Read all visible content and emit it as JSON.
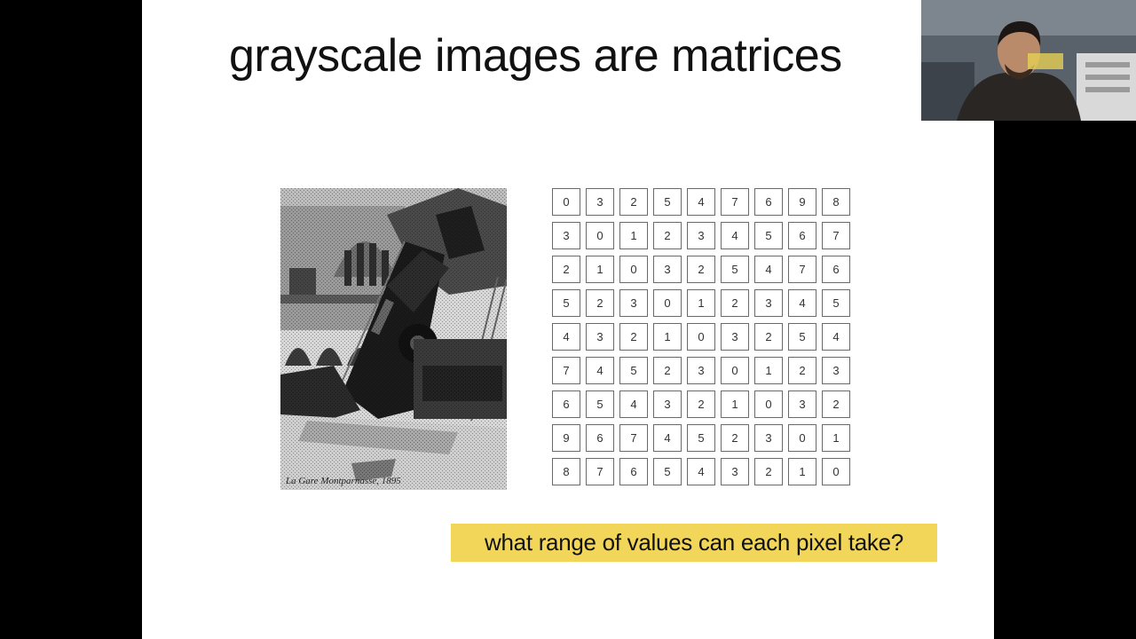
{
  "slide": {
    "title": "grayscale images are matrices",
    "question": "what range of values can each pixel take?",
    "photo_caption": "La Gare Montparnasse, 1895"
  },
  "matrix": {
    "rows": [
      [
        0,
        3,
        2,
        5,
        4,
        7,
        6,
        9,
        8
      ],
      [
        3,
        0,
        1,
        2,
        3,
        4,
        5,
        6,
        7
      ],
      [
        2,
        1,
        0,
        3,
        2,
        5,
        4,
        7,
        6
      ],
      [
        5,
        2,
        3,
        0,
        1,
        2,
        3,
        4,
        5
      ],
      [
        4,
        3,
        2,
        1,
        0,
        3,
        2,
        5,
        4
      ],
      [
        7,
        4,
        5,
        2,
        3,
        0,
        1,
        2,
        3
      ],
      [
        6,
        5,
        4,
        3,
        2,
        1,
        0,
        3,
        2
      ],
      [
        9,
        6,
        7,
        4,
        5,
        2,
        3,
        0,
        1
      ],
      [
        8,
        7,
        6,
        5,
        4,
        3,
        2,
        1,
        0
      ]
    ]
  },
  "colors": {
    "slide_background": "#ffffff",
    "letterbox": "#000000",
    "highlight": "#f2d65a",
    "cell_border": "#6a6a6a"
  },
  "icons": {
    "photo": "grayscale-train-photo",
    "webcam": "presenter-webcam-feed"
  }
}
